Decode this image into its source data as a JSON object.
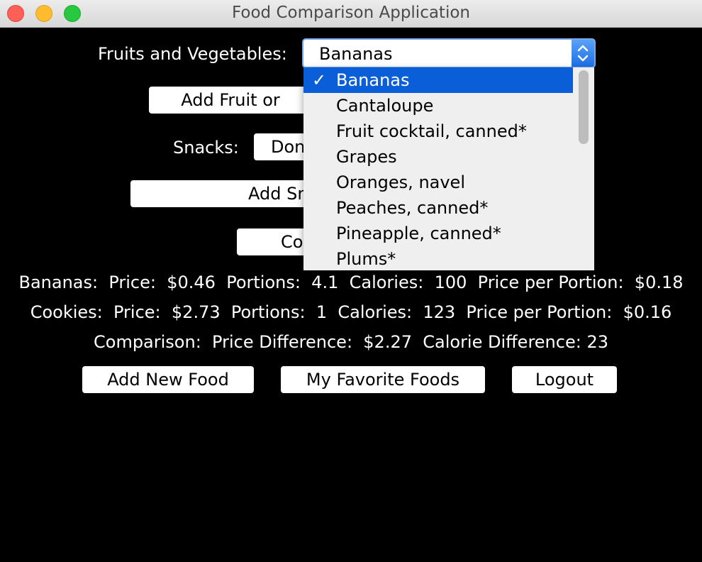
{
  "window": {
    "title": "Food Comparison Application"
  },
  "fruits": {
    "label": "Fruits and Vegetables:",
    "selected": "Bananas",
    "options": [
      "Bananas",
      "Cantaloupe",
      "Fruit cocktail, canned*",
      "Grapes",
      "Oranges, navel",
      "Peaches, canned*",
      "Pineapple, canned*",
      "Plums*"
    ],
    "check_mark": "✓",
    "add_button": "Add Fruit or"
  },
  "snacks": {
    "label": "Snacks:",
    "selected_partial": "Don",
    "add_button": "Add Sn"
  },
  "compare_button": "Co",
  "info": {
    "line1": "Bananas:  Price:  $0.46  Portions:  4.1  Calories:  100  Price per Portion:  $0.18",
    "line2": "Cookies:  Price:  $2.73  Portions:  1  Calories:  123  Price per Portion:  $0.16",
    "line3": "Comparison:  Price Difference:  $2.27  Calorie Difference: 23"
  },
  "buttons": {
    "add_new_food": "Add New Food",
    "favorites": "My Favorite Foods",
    "logout": "Logout"
  },
  "colors": {
    "background": "#000000",
    "selection": "#0a5fd8",
    "combo_arrows": "#1d6fe5"
  }
}
